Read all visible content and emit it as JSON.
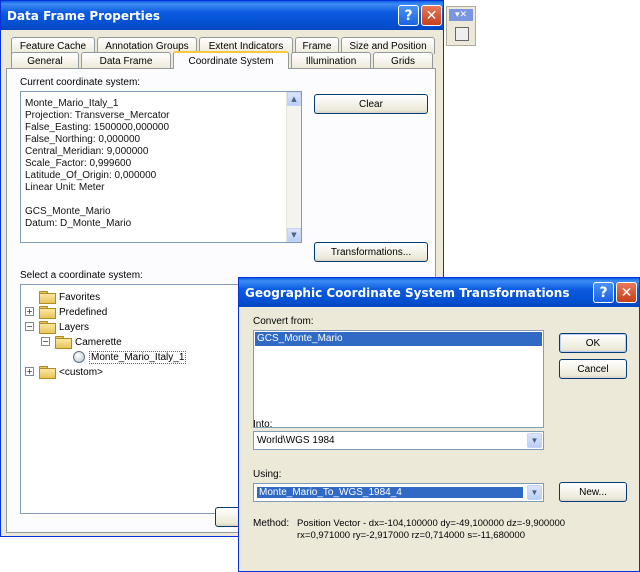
{
  "dialog1": {
    "title": "Data Frame Properties",
    "tabs_row1": [
      "Feature Cache",
      "Annotation Groups",
      "Extent Indicators",
      "Frame",
      "Size and Position"
    ],
    "tabs_row2": [
      "General",
      "Data Frame",
      "Coordinate System",
      "Illumination",
      "Grids"
    ],
    "active_tab": "Coordinate System",
    "current_cs_label": "Current coordinate system:",
    "current_cs_lines": [
      "Monte_Mario_Italy_1",
      "Projection: Transverse_Mercator",
      "False_Easting: 1500000,000000",
      "False_Northing: 0,000000",
      "Central_Meridian: 9,000000",
      "Scale_Factor: 0,999600",
      "Latitude_Of_Origin: 0,000000",
      "Linear Unit: Meter",
      "",
      "GCS_Monte_Mario",
      "Datum: D_Monte_Mario"
    ],
    "clear_button": "Clear",
    "transformations_button": "Transformations...",
    "select_cs_label": "Select a coordinate system:",
    "tree": {
      "favorites": "Favorites",
      "predefined": "Predefined",
      "layers": "Layers",
      "camerette": "Camerette",
      "monte_mario": "Monte_Mario_Italy_1",
      "custom": "<custom>"
    }
  },
  "dialog2": {
    "title": "Geographic Coordinate System Transformations",
    "convert_from_label": "Convert from:",
    "convert_from_items": [
      "GCS_Monte_Mario"
    ],
    "ok_button": "OK",
    "cancel_button": "Cancel",
    "into_label": "Into:",
    "into_value": "World\\WGS 1984",
    "using_label": "Using:",
    "using_value": "Monte_Mario_To_WGS_1984_4",
    "new_button": "New...",
    "method_label": "Method:",
    "method_line1": "Position Vector - dx=-104,100000 dy=-49,100000 dz=-9,900000",
    "method_line2": "rx=0,971000 ry=-2,917000 rz=0,714000 s=-11,680000"
  },
  "colors": {
    "titlebar": "#0558d8",
    "dialog_bg": "#ece9d8",
    "selection": "#316ac5",
    "close_button": "#d9582d",
    "active_tab_accent": "#ffc83c"
  }
}
